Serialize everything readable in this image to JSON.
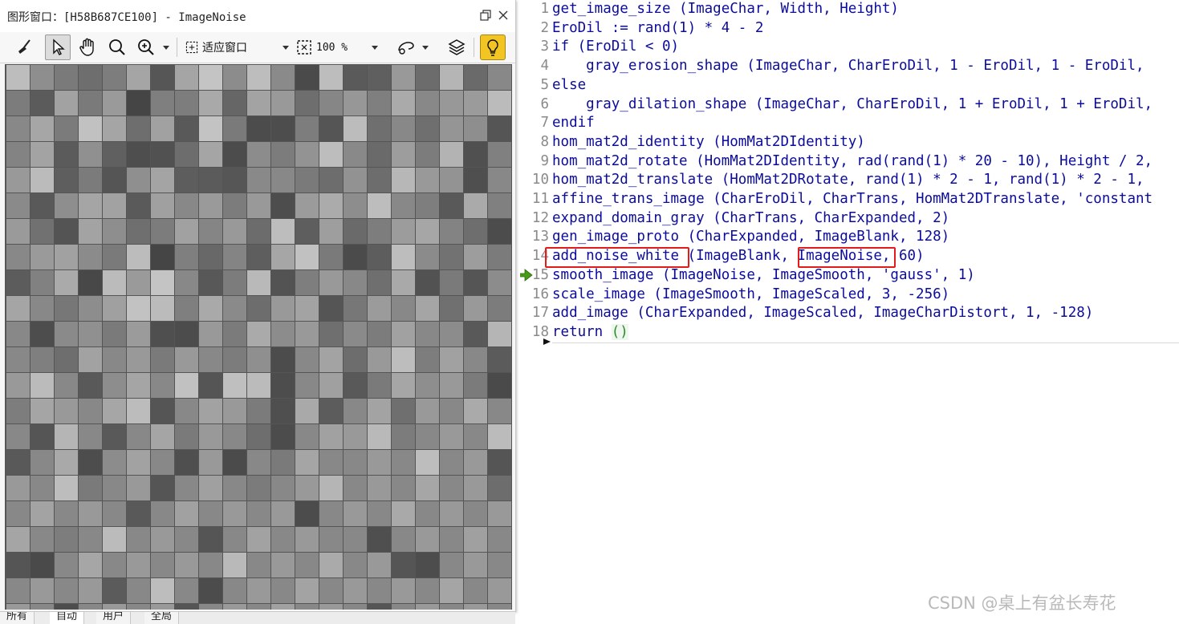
{
  "graphics_window": {
    "title": "图形窗口：[H58B687CE100] - ImageNoise",
    "toolbar": {
      "fit_label": "适应窗口",
      "zoom_label": "100 %"
    },
    "bottom_tabs": [
      "所有",
      "自动",
      "用户",
      "全局"
    ],
    "noise_pixels": [
      "#bdbdbd",
      "#8e8e8e",
      "#7a7a7a",
      "#6e6e6e",
      "#7d7d7d",
      "#a5a5a5",
      "#565656",
      "#a5a5a5",
      "#c4c4c4",
      "#8c8c8c",
      "#bdbdbd",
      "#8a8a8a",
      "#4a4a4a",
      "#bdbdbd",
      "#5a5a5a",
      "#5f5f5f",
      "#999",
      "#6c6c6c",
      "#b5b5b5",
      "#6a6a6a",
      "#888",
      "#7c7c7c",
      "#5b5b5b",
      "#a2a2a2",
      "#7a7a7a",
      "#9a9a9a",
      "#454545",
      "#7f7f7f",
      "#7d7d7d",
      "#a9a9a9",
      "#666",
      "#a3a3a3",
      "#999",
      "#6e6e6e",
      "#868686",
      "#979797",
      "#7f7f7f",
      "#aaa",
      "#888",
      "#989898",
      "#9b9b9b",
      "#bbb",
      "#888",
      "#a6a6a6",
      "#7b7b7b",
      "#c1c1c1",
      "#a5a5a5",
      "#6e6e6e",
      "#a1a1a1",
      "#595959",
      "#c3c3c3",
      "#7a7a7a",
      "#4c4c4c",
      "#4d4d4d",
      "#7d7d7d",
      "#555",
      "#bcbcbc",
      "#6f6f6f",
      "#888",
      "#6f6f6f",
      "#959595",
      "#8e8e8e",
      "#555",
      "#838383",
      "#a3a3a3",
      "#5b5b5b",
      "#909090",
      "#606060",
      "#4e4e4e",
      "#515151",
      "#6d6d6d",
      "#a5a5a5",
      "#4c4c4c",
      "#8c8c8c",
      "#7c7c7c",
      "#939393",
      "#bdbdbd",
      "#898989",
      "#6a6a6a",
      "#9d9d9d",
      "#7c7c7c",
      "#b3b3b3",
      "#505050",
      "#808080",
      "#999",
      "#bbb",
      "#5e5e5e",
      "#7b7b7b",
      "#555",
      "#8f8f8f",
      "#a4a4a4",
      "#5d5d5d",
      "#5b5b5b",
      "#565656",
      "#898989",
      "#888",
      "#7a7a7a",
      "#6d6d6d",
      "#929292",
      "#6d6d6d",
      "#b7b7b7",
      "#999",
      "#939393",
      "#4f4f4f",
      "#888",
      "#8a8a8a",
      "#595959",
      "#8e8e8e",
      "#a5a5a5",
      "#a2a2a2",
      "#5a5a5a",
      "#a0a0a0",
      "#888",
      "#9a9a9a",
      "#7c7c7c",
      "#999",
      "#4d4d4d",
      "#9b9b9b",
      "#ababab",
      "#8d8d8d",
      "#bdbdbd",
      "#888",
      "#7e7e7e",
      "#595959",
      "#aaa",
      "#808080",
      "#9a9a9a",
      "#717171",
      "#545454",
      "#a3a3a3",
      "#8e8e8e",
      "#6f6f6f",
      "#7c7c7c",
      "#a1a1a1",
      "#858585",
      "#999",
      "#6c6c6c",
      "#bdbdbd",
      "#5e5e5e",
      "#9e9e9e",
      "#6a6a6a",
      "#7d7d7d",
      "#9c9c9c",
      "#a6a6a6",
      "#838383",
      "#6e6e6e",
      "#4c4c4c",
      "#888",
      "#9a9a9a",
      "#a1a1a1",
      "#8b8b8b",
      "#7a7a7a",
      "#bcbcbc",
      "#454545",
      "#7f7f7f",
      "#686868",
      "#848484",
      "#5e5e5e",
      "#a6a6a6",
      "#c1c1c1",
      "#7a7a7a",
      "#4b4b4b",
      "#5d5d5d",
      "#bdbdbd",
      "#8b8b8b",
      "#727272",
      "#9d9d9d",
      "#7b7b7b",
      "#5c5c5c",
      "#818181",
      "#aaa",
      "#484848",
      "#bbb",
      "#9a9a9a",
      "#c4c4c4",
      "#888",
      "#585858",
      "#7c7c7c",
      "#b9b9b9",
      "#535353",
      "#7e7e7e",
      "#999",
      "#888",
      "#6f6f6f",
      "#a9a9a9",
      "#525252",
      "#7a7a7a",
      "#555",
      "#8c8c8c",
      "#a5a5a5",
      "#888",
      "#777",
      "#8d8d8d",
      "#a0a0a0",
      "#c2c2c2",
      "#bbb",
      "#7f7f7f",
      "#a9a9a9",
      "#8a8a8a",
      "#6d6d6d",
      "#999",
      "#a3a3a3",
      "#555",
      "#777",
      "#9b9b9b",
      "#888",
      "#a5a5a5",
      "#707070",
      "#999",
      "#7c7c7c",
      "#888",
      "#4d4d4d",
      "#8a8a8a",
      "#909090",
      "#7a7a7a",
      "#9b9b9b",
      "#4f4f4f",
      "#4c4c4c",
      "#999",
      "#7b7b7b",
      "#aaa",
      "#8c8c8c",
      "#999",
      "#6f6f6f",
      "#8a8a8a",
      "#7c7c7c",
      "#a1a1a1",
      "#888",
      "#8c8c8c",
      "#595959",
      "#b5b5b5",
      "#888",
      "#7f7f7f",
      "#6e6e6e",
      "#a2a2a2",
      "#888",
      "#999",
      "#7a7a7a",
      "#999",
      "#888",
      "#7c7c7c",
      "#8f8f8f",
      "#4c4c4c",
      "#888",
      "#a3a3a3",
      "#6d6d6d",
      "#999",
      "#bdbdbd",
      "#7d7d7d",
      "#a1a1a1",
      "#888",
      "#5b5b5b",
      "#999",
      "#bbb",
      "#888",
      "#595959",
      "#8d8d8d",
      "#a5a5a5",
      "#888",
      "#c1c1c1",
      "#555",
      "#bfbfbf",
      "#bbb",
      "#4d4d4d",
      "#888",
      "#a0a0a0",
      "#595959",
      "#7a7a7a",
      "#a6a6a6",
      "#8e8e8e",
      "#999",
      "#7b7b7b",
      "#4a4a4a",
      "#7d7d7d",
      "#a5a5a5",
      "#999",
      "#888",
      "#a6a6a6",
      "#bcbcbc",
      "#555",
      "#888",
      "#a2a2a2",
      "#999",
      "#7b7b7b",
      "#4f4f4f",
      "#a9a9a9",
      "#5c5c5c",
      "#888",
      "#a3a3a3",
      "#6f6f6f",
      "#999",
      "#888",
      "#aaa",
      "#888",
      "#888",
      "#555",
      "#b5b5b5",
      "#888",
      "#595959",
      "#888",
      "#a5a5a5",
      "#7a7a7a",
      "#999",
      "#888",
      "#6e6e6e",
      "#4c4c4c",
      "#888",
      "#a1a1a1",
      "#999",
      "#b9b9b9",
      "#7c7c7c",
      "#888",
      "#999",
      "#888",
      "#bbb",
      "#595959",
      "#888",
      "#a9a9a9",
      "#4d4d4d",
      "#8c8c8c",
      "#a2a2a2",
      "#888",
      "#4f4f4f",
      "#999",
      "#4b4b4b",
      "#888",
      "#7a7a7a",
      "#a5a5a5",
      "#888",
      "#888",
      "#999",
      "#888",
      "#bdbdbd",
      "#888",
      "#999",
      "#555",
      "#999",
      "#888",
      "#bdbdbd",
      "#7a7a7a",
      "#888",
      "#999",
      "#555",
      "#888",
      "#a0a0a0",
      "#888",
      "#7b7b7b",
      "#888",
      "#999",
      "#b5b5b5",
      "#888",
      "#999",
      "#888",
      "#a6a6a6",
      "#888",
      "#999",
      "#6d6d6d",
      "#888",
      "#a3a3a3",
      "#888",
      "#999",
      "#888",
      "#595959",
      "#888",
      "#a1a1a1",
      "#888",
      "#999",
      "#888",
      "#999",
      "#4c4c4c",
      "#888",
      "#999",
      "#888",
      "#a9a9a9",
      "#888",
      "#999",
      "#888",
      "#999",
      "#a5a5a5",
      "#888",
      "#7d7d7d",
      "#888",
      "#bbb",
      "#888",
      "#999",
      "#888",
      "#555",
      "#888",
      "#a2a2a2",
      "#888",
      "#999",
      "#888",
      "#888",
      "#4f4f4f",
      "#888",
      "#999",
      "#888",
      "#a0a0a0",
      "#888",
      "#555",
      "#4a4a4a",
      "#888",
      "#a6a6a6",
      "#888",
      "#999",
      "#888",
      "#999",
      "#888",
      "#b9b9b9",
      "#888",
      "#999",
      "#888",
      "#aaa",
      "#888",
      "#999",
      "#555",
      "#4d4d4d",
      "#888",
      "#999",
      "#888",
      "#888",
      "#999",
      "#888",
      "#999",
      "#5b5b5b",
      "#888",
      "#bdbdbd",
      "#888",
      "#4c4c4c",
      "#888",
      "#999",
      "#888",
      "#a3a3a3",
      "#888",
      "#999",
      "#888",
      "#999",
      "#888",
      "#a5a5a5",
      "#888",
      "#999",
      "#999",
      "#888",
      "#4d4d4d",
      "#888",
      "#999",
      "#888",
      "#999",
      "#555",
      "#888",
      "#999",
      "#888",
      "#a1a1a1",
      "#888",
      "#999",
      "#888",
      "#555",
      "#888",
      "#999",
      "#888",
      "#999",
      "#888",
      "#888",
      "#a9a9a9",
      "#888",
      "#999",
      "#888",
      "#bbb",
      "#888",
      "#999",
      "#888",
      "#4f4f4f",
      "#888",
      "#999",
      "#888",
      "#999",
      "#888",
      "#a0a0a0",
      "#888",
      "#999",
      "#888",
      "#555",
      "#888"
    ]
  },
  "editor": {
    "lines": [
      {
        "n": "1",
        "text": "get_image_size (ImageChar, Width, Height)"
      },
      {
        "n": "2",
        "text": "EroDil := rand(1) * 4 - 2"
      },
      {
        "n": "3",
        "text": "if (EroDil < 0)"
      },
      {
        "n": "4",
        "text": "    gray_erosion_shape (ImageChar, CharEroDil, 1 - EroDil, 1 - EroDil,"
      },
      {
        "n": "5",
        "text": "else"
      },
      {
        "n": "6",
        "text": "    gray_dilation_shape (ImageChar, CharEroDil, 1 + EroDil, 1 + EroDil,"
      },
      {
        "n": "7",
        "text": "endif"
      },
      {
        "n": "8",
        "text": "hom_mat2d_identity (HomMat2DIdentity)"
      },
      {
        "n": "9",
        "text": "hom_mat2d_rotate (HomMat2DIdentity, rad(rand(1) * 20 - 10), Height / 2,"
      },
      {
        "n": "10",
        "text": "hom_mat2d_translate (HomMat2DRotate, rand(1) * 2 - 1, rand(1) * 2 - 1,"
      },
      {
        "n": "11",
        "text": "affine_trans_image (CharEroDil, CharTrans, HomMat2DTranslate, 'constant"
      },
      {
        "n": "12",
        "text": "expand_domain_gray (CharTrans, CharExpanded, 2)"
      },
      {
        "n": "13",
        "text": "gen_image_proto (CharExpanded, ImageBlank, 128)"
      },
      {
        "n": "14",
        "text": "add_noise_white (ImageBlank, ImageNoise, 60)"
      },
      {
        "n": "15",
        "text": "smooth_image (ImageNoise, ImageSmooth, 'gauss', 1)"
      },
      {
        "n": "16",
        "text": "scale_image (ImageSmooth, ImageScaled, 3, -256)"
      },
      {
        "n": "17",
        "text": "add_image (CharExpanded, ImageScaled, ImageCharDistort, 1, -128)"
      },
      {
        "n": "18",
        "text": "return ()"
      }
    ],
    "watermark": "CSDN @桌上有盆长寿花"
  },
  "colors": {
    "code": "#0c0c9c",
    "highlight_box": "#e31b1b",
    "exec_arrow": "#4a9a1a",
    "bulb": "#f3c522"
  }
}
